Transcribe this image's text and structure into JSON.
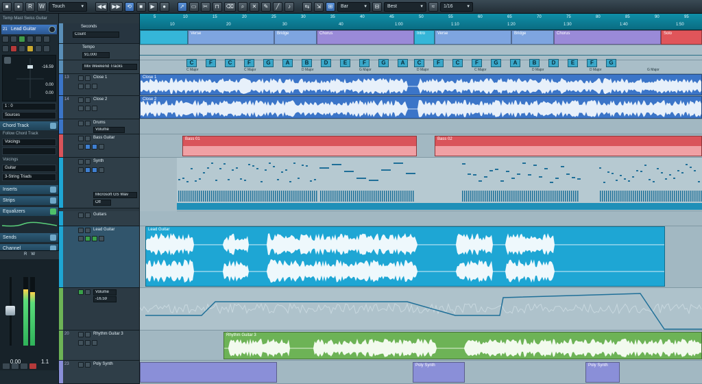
{
  "toolbar": {
    "automation_mode": "Touch",
    "grid_type": "Bar",
    "snap_mode": "Best",
    "quantize": "1/16"
  },
  "inspector": {
    "project_title": "Temp Mast Swiss Guitar",
    "track_number": "21",
    "track_name": "Lead Guitar",
    "volume_value": "-16.59",
    "pan_value": "0.00",
    "pan_value2": "0.00",
    "delay_value": "1 : 0",
    "sends_label": "Sources",
    "sections": {
      "chord_track": "Chord Track",
      "follow_chord_track": "Follow Chord Track",
      "voicings_field": "Voicings",
      "voicings_label": "Voicings",
      "voicing_type": "Guitar",
      "voicing_preset": "3-String Triads",
      "inserts": "Inserts",
      "strips": "Strips",
      "equalizers": "Equalizers",
      "sends": "Sends",
      "channel": "Channel"
    },
    "mixer": {
      "label_r": "R",
      "label_w": "W",
      "value_left": "0.00",
      "value_right": "1.1"
    }
  },
  "tracks": {
    "ruler_name": "Seconds",
    "ruler_mode": "Count",
    "tempo_name": "Tempo",
    "tempo_value": "91.000",
    "chord_name": "Mix Weekend Tracks",
    "close1": "Close 1",
    "close2": "Close 2",
    "drums": "Drums",
    "drums_field": "Volume",
    "bass": "Bass Guitar",
    "synth": "Synth",
    "synth_instrument": "Microsoft GS Wav",
    "synth_off": "Off",
    "guitars": "Guitars",
    "lead": "Lead Guitar",
    "synth_auto": "Synth",
    "auto_param": "Volume",
    "auto_value": "-16.59",
    "rhythm": "Rhythm Guitar 3",
    "poly": "Poly Synth"
  },
  "ruler": {
    "bars_top": [
      "5",
      "10",
      "15",
      "20",
      "25",
      "30",
      "35",
      "40",
      "45",
      "50",
      "55",
      "60",
      "65",
      "70",
      "75",
      "80",
      "85",
      "90",
      "95"
    ],
    "times": [
      "10",
      "20",
      "30",
      "40",
      "1:00",
      "1:10",
      "1:20",
      "1:30",
      "1:40",
      "1:50"
    ]
  },
  "markers": [
    "Verse",
    "Bridge",
    "Chorus",
    "Intro",
    "Verse",
    "Bridge",
    "Chorus",
    "Solo"
  ],
  "chords": [
    "C",
    "F",
    "C",
    "F",
    "G",
    "A",
    "B",
    "D",
    "E",
    "F",
    "G",
    "A",
    "C",
    "F",
    "C",
    "F",
    "G",
    "A",
    "B",
    "D",
    "E",
    "F",
    "G"
  ],
  "chord_subs": [
    "C Major",
    "C Major",
    "D Major",
    "G Major",
    "D Major",
    "C Major",
    "D Major",
    "D Major",
    "G Major"
  ],
  "parts": {
    "close1": "Close 1",
    "close2": "Close 2",
    "bass1": "Bass 01",
    "bass2": "Bass 02",
    "lead": "Lead Guitar",
    "rhythm": "Rhythm Guitar 3",
    "poly1": "Poly Synth",
    "poly2": "Poly Synth"
  },
  "colors": {
    "ruler": "#0f8fa8",
    "audio_blue": "#3b75c8",
    "bass_red": "#d9545a",
    "lead_cyan": "#1ea6d4",
    "rhythm_green": "#6db356",
    "poly_purple": "#8a8fd8"
  }
}
